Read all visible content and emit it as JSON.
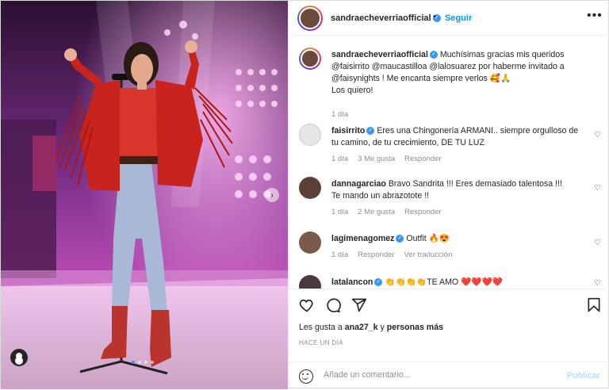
{
  "post": {
    "author": "sandraecheverriaofficial",
    "follow_label": "Seguir",
    "more_label": "•••",
    "separator": "•"
  },
  "caption": {
    "user": "sandraecheverriaofficial",
    "text_line1": " Muchísimas gracias mis queridos",
    "text_line2": "@faisirrito @maucastilloa @lalosuarez por haberme invitado a",
    "text_line3": "@faisynights ! Me encanta siempre verlos 🥰🙏",
    "text_line4": "Los quiero!",
    "time": "1 día"
  },
  "comments": [
    {
      "user": "faisirrito",
      "line1": " Eres una Chingonería ARMANI.. siempre orgulloso de",
      "line2": "tu camino, de tu crecimiento, DE TU LUZ",
      "time": "1 día",
      "likes": "3 Me gusta",
      "reply": "Responder"
    },
    {
      "user": "dannagarciao",
      "line1": " Bravo Sandrita !!! Eres demasiado talentosa !!!",
      "line2": "Te mando un abrazotote !!",
      "time": "1 día",
      "likes": "2 Me gusta",
      "reply": "Responder"
    },
    {
      "user": "lagimenagomez",
      "line1": " Outfit 🔥😍",
      "line2": "",
      "time": "1 día",
      "likes": "Responder",
      "reply": "Ver traducción"
    },
    {
      "user": "latalancon",
      "line1": " 👏👏👏👏TE AMO ❤️❤️❤️❤️",
      "line2": "",
      "time": "",
      "likes": "",
      "reply": ""
    }
  ],
  "likes": {
    "prefix": "Les gusta a ",
    "user": "ana27_k",
    "suffix": " y ",
    "more": "personas más"
  },
  "time_ago": "HACE UN DÍA",
  "add_comment": {
    "placeholder": "Añade un comentario...",
    "publish_label": "Publicar"
  },
  "icons": {
    "like": "heart-icon",
    "comment": "comment-icon",
    "share": "share-icon",
    "save": "bookmark-icon",
    "emoji": "emoji-icon",
    "more": "more-options-icon"
  },
  "colors": {
    "accent": "#0095f6",
    "verified": "#3897f0",
    "muted": "#8e8e8e",
    "publish_disabled": "#b2dffc"
  }
}
